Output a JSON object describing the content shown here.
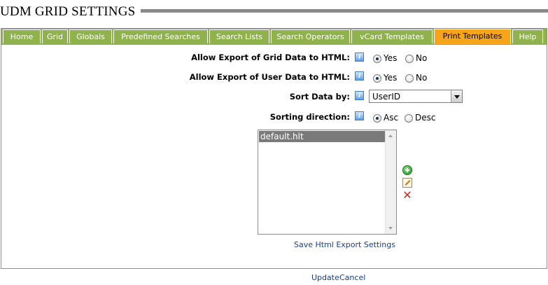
{
  "page": {
    "title": "UDM GRID SETTINGS"
  },
  "tabs": [
    {
      "label": "Home",
      "active": false
    },
    {
      "label": "Grid",
      "active": false
    },
    {
      "label": "Globals",
      "active": false
    },
    {
      "label": "Predefined Searches",
      "active": false
    },
    {
      "label": "Search Lists",
      "active": false
    },
    {
      "label": "Search Operators",
      "active": false
    },
    {
      "label": "vCard Templates",
      "active": false
    },
    {
      "label": "Print Templates",
      "active": true
    },
    {
      "label": "Help",
      "active": false
    }
  ],
  "form": {
    "export_grid": {
      "label": "Allow Export of Grid Data to HTML:",
      "yes": "Yes",
      "no": "No",
      "selected": "Yes"
    },
    "export_user": {
      "label": "Allow Export of User Data to HTML:",
      "yes": "Yes",
      "no": "No",
      "selected": "Yes"
    },
    "sort_by": {
      "label": "Sort Data by:",
      "value": "UserID"
    },
    "sort_dir": {
      "label": "Sorting direction:",
      "asc": "Asc",
      "desc": "Desc",
      "selected": "Asc"
    },
    "info_icon": "info-icon"
  },
  "templates": {
    "items": [
      "default.hlt"
    ],
    "selected": "default.hlt",
    "add_icon": "add-icon",
    "edit_icon": "edit-icon",
    "delete_icon": "delete-icon"
  },
  "actions": {
    "save_settings": "Save Html Export Settings",
    "update": "Update",
    "cancel": "Cancel"
  },
  "colors": {
    "tab_bar": "#8fb24c",
    "tab_active": "#f6a51b",
    "link": "#1c3e8a",
    "delete": "#d2231e",
    "add": "#1e8f1e"
  }
}
